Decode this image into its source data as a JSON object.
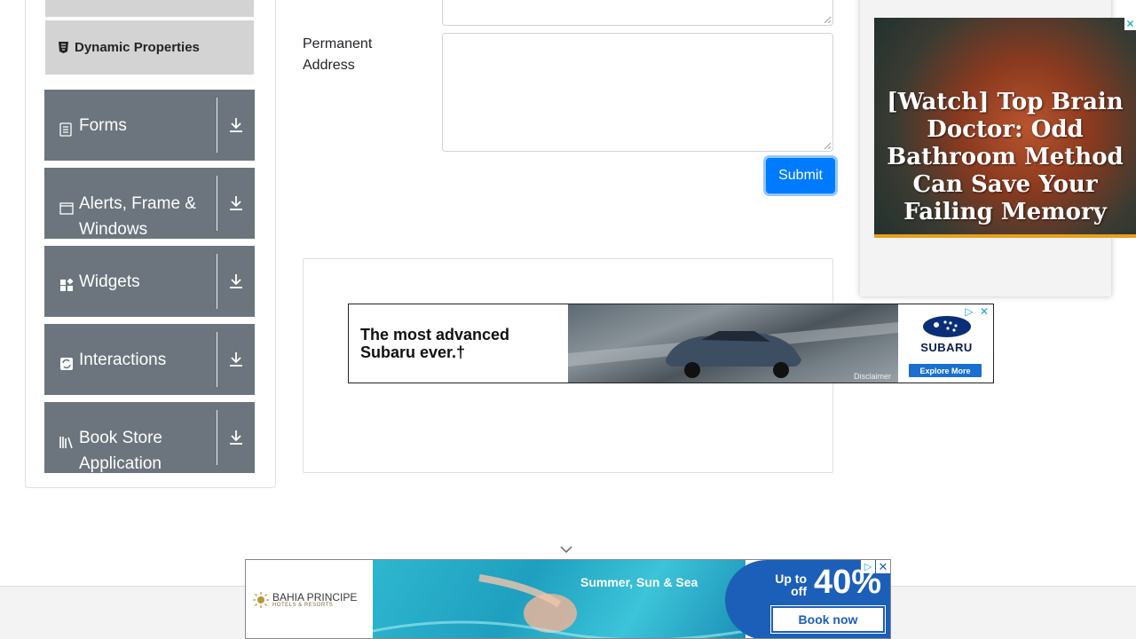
{
  "sidebar": {
    "active_item": {
      "label": "Dynamic Properties",
      "icon": "html5-shield-icon"
    },
    "groups": [
      {
        "label": "Forms",
        "icon": "form-icon"
      },
      {
        "label": "Alerts, Frame & Windows",
        "icon": "window-icon"
      },
      {
        "label": "Widgets",
        "icon": "widgets-icon"
      },
      {
        "label": "Interactions",
        "icon": "interactions-icon"
      },
      {
        "label": "Book Store Application",
        "icon": "books-icon"
      }
    ]
  },
  "form": {
    "permanent_address_label": "Permanent Address",
    "permanent_address_value": "",
    "submit_label": "Submit"
  },
  "ads": {
    "subaru": {
      "headline": "The most advanced Subaru ever.†",
      "brand": "SUBARU",
      "cta": "Explore More",
      "disclaimer": "Disclaimer"
    },
    "right": {
      "headline": "[Watch] Top Brain Doctor: Odd Bathroom Method Can Save Your Failing Memory",
      "close": "✕"
    },
    "bahia": {
      "brand": "BAHIA PRINCIPE",
      "brand_sub": "HOTELS & RESORTS",
      "tagline": "Summer, Sun & Sea",
      "upto": "Up to",
      "off": "off",
      "percent": "40%",
      "cta": "Book now"
    }
  },
  "colors": {
    "primary": "#007bff",
    "sidebar_group": "#6c757d",
    "active_item": "#d3d3d3"
  }
}
